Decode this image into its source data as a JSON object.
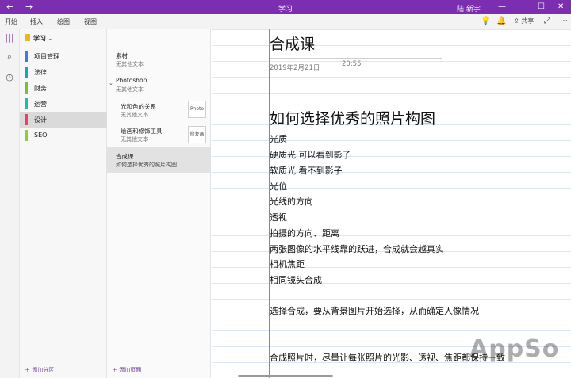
{
  "titlebar": {
    "back_icon": "←",
    "forward_icon": "→",
    "title": "学习",
    "user": "陆 新宇",
    "minimize_icon": "—",
    "maximize_icon": "☐",
    "close_icon": "✕",
    "color": "#7b2fb0"
  },
  "menu": {
    "items": [
      "开始",
      "插入",
      "绘图",
      "视图"
    ],
    "share_label": "共享"
  },
  "notebook": {
    "name": "学习",
    "sections": [
      {
        "label": "项目管理",
        "color": "#3e7fd3"
      },
      {
        "label": "法律",
        "color": "#1aa6b7"
      },
      {
        "label": "财务",
        "color": "#7cc133"
      },
      {
        "label": "运营",
        "color": "#26b8a8"
      },
      {
        "label": "设计",
        "color": "#e8416b",
        "selected": true
      },
      {
        "label": "SEO",
        "color": "#8fcc3d"
      }
    ],
    "add_section_label": "添加分区"
  },
  "pages": {
    "items": [
      {
        "title": "素材",
        "subtitle": "无其他文本"
      },
      {
        "title": "Photoshop",
        "subtitle": "无其他文本"
      },
      {
        "title": "光和色的关系",
        "subtitle": "无其他文本",
        "thumb": "Photo"
      },
      {
        "title": "绘画和修饰工具",
        "subtitle": "无其他文本",
        "thumb": "修复画"
      },
      {
        "title": "合成课",
        "subtitle": "如何选择优秀的照片构图"
      }
    ],
    "add_page_label": "添加页面"
  },
  "page": {
    "title": "合成课",
    "date": "2019年2月21日",
    "time": "20:55",
    "heading": "如何选择优秀的照片构图",
    "lines": [
      "光质",
      "硬质光 可以看到影子",
      "软质光 看不到影子",
      "光位",
      "光线的方向",
      "透视",
      "拍摄的方向、距离",
      "两张图像的水平线靠的跃进，合成就会越真实",
      "相机焦距",
      "相同镜头合成",
      "",
      "选择合成，要从背景图片开始选择，从而确定人像情况",
      "",
      "",
      "合成照片时，尽量让每张照片的光影、透视、焦距都保持一致"
    ]
  },
  "watermark": "AppSo"
}
